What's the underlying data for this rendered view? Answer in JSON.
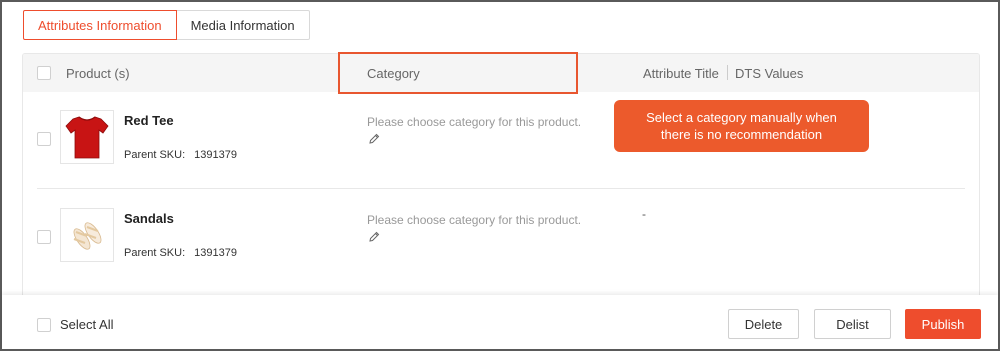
{
  "tabs": [
    {
      "label": "Attributes Information",
      "active": true
    },
    {
      "label": "Media Information",
      "active": false
    }
  ],
  "table": {
    "headers": {
      "product": "Product (s)",
      "category": "Category",
      "attribute_title": "Attribute Title",
      "dts_values": "DTS Values"
    },
    "rows": [
      {
        "name": "Red Tee",
        "sku_label": "Parent SKU:",
        "sku_value": "1391379",
        "image": "red-tshirt-icon",
        "category_placeholder": "Please choose category for this product.",
        "dts_value": ""
      },
      {
        "name": "Sandals",
        "sku_label": "Parent SKU:",
        "sku_value": "1391379",
        "image": "sandals-icon",
        "category_placeholder": "Please choose category for this product.",
        "dts_value": "-"
      }
    ]
  },
  "callout": {
    "line1": "Select a category manually when",
    "line2": "there is no recommendation"
  },
  "footer": {
    "select_all": "Select All",
    "delete": "Delete",
    "delist": "Delist",
    "publish": "Publish"
  },
  "colors": {
    "accent": "#ee4d2d",
    "callout": "#ec5a2c",
    "header_bg": "#f5f5f5"
  }
}
